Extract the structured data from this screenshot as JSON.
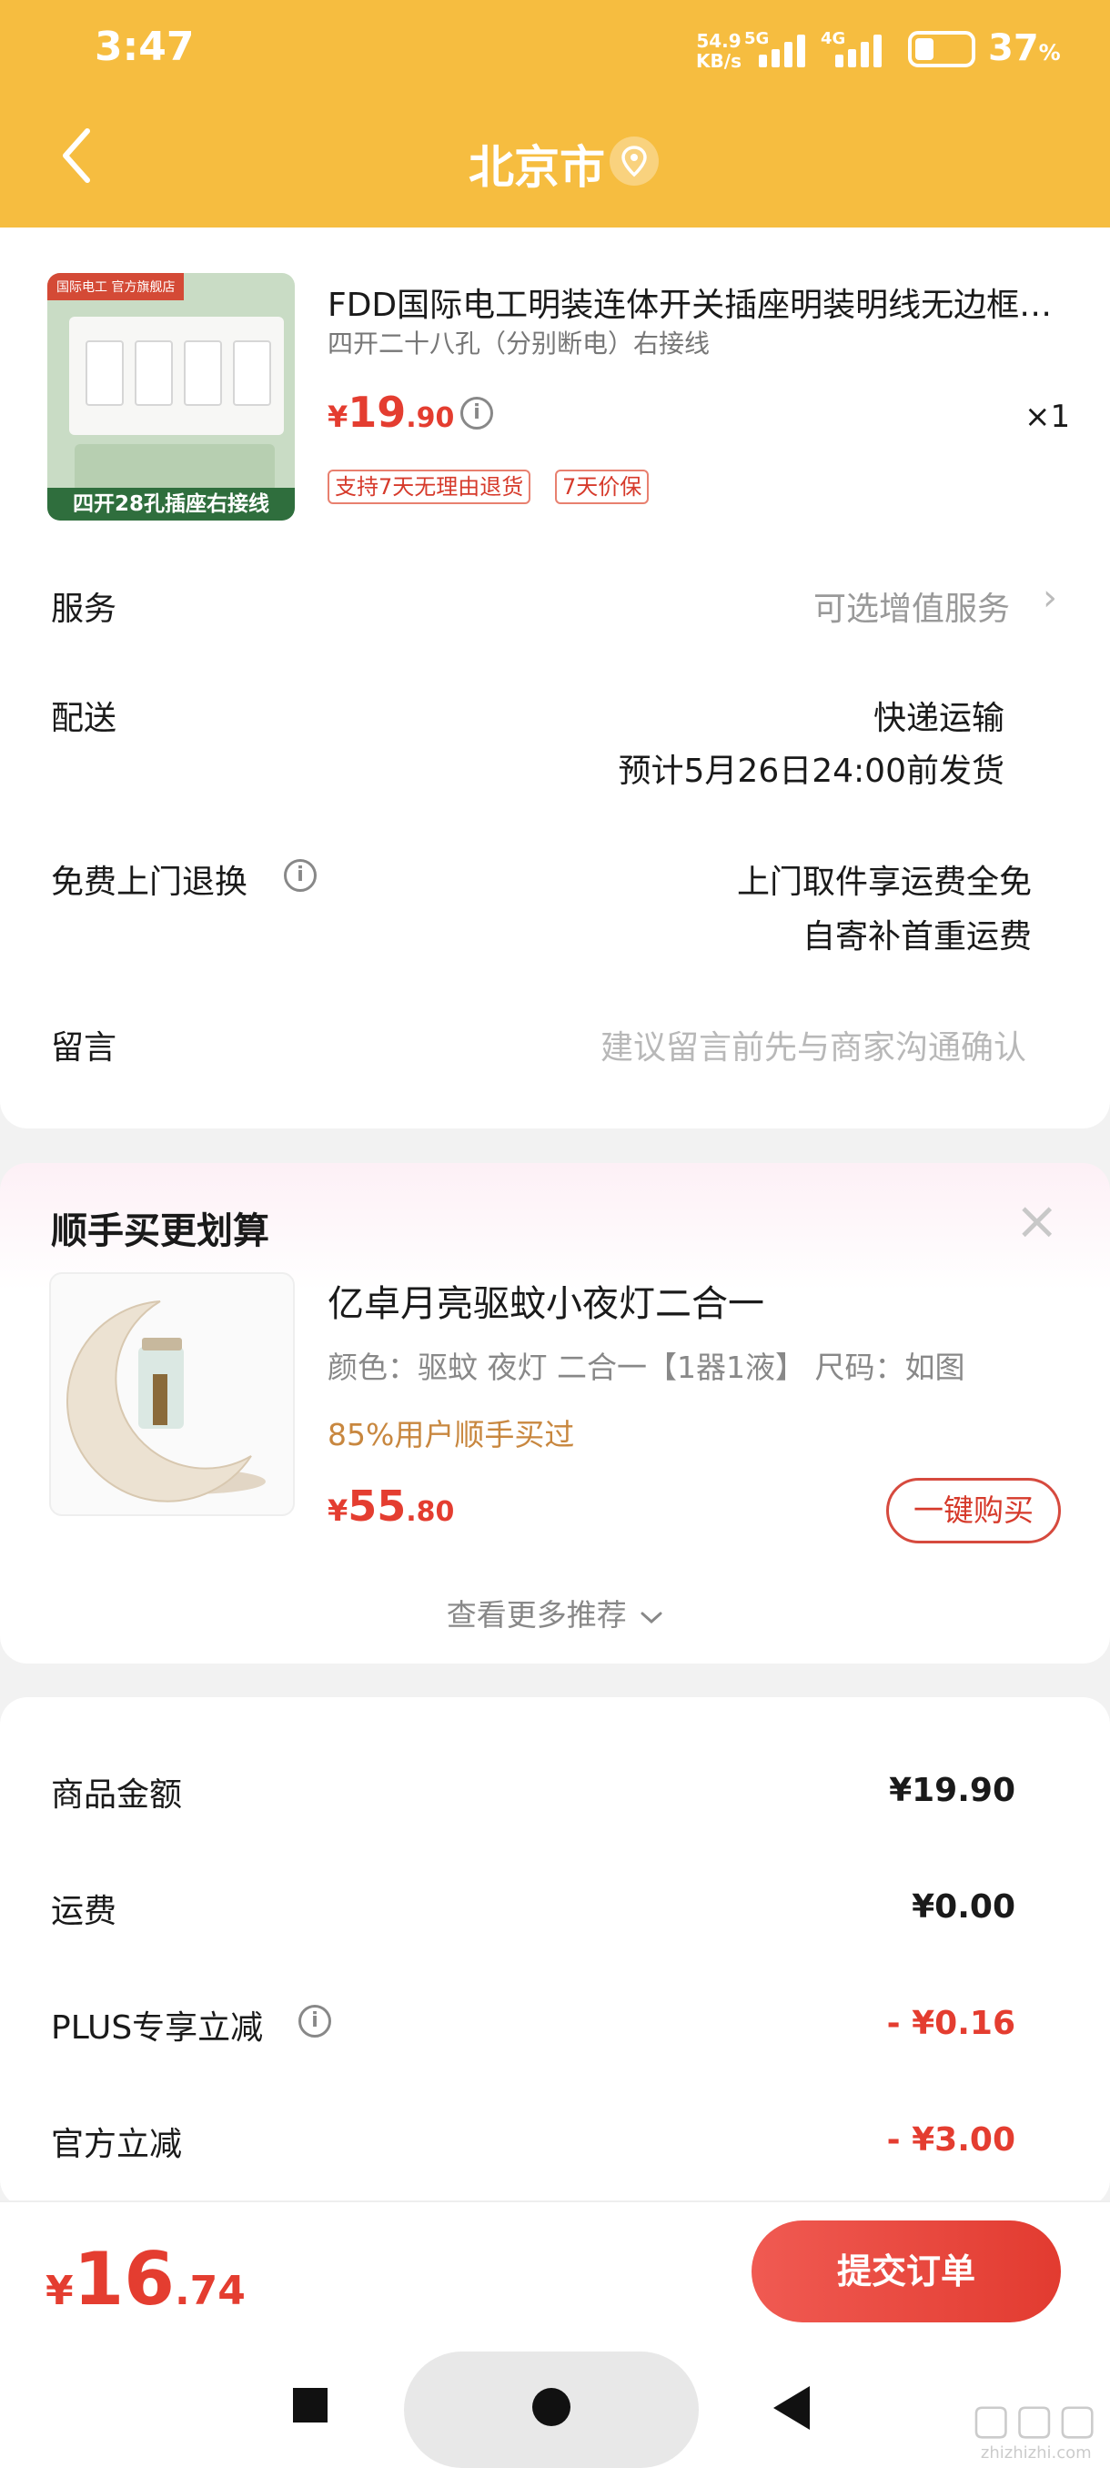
{
  "status": {
    "time": "3:47",
    "net_speed_value": "54.9",
    "net_speed_unit": "KB/s",
    "sig1_tag": "5G",
    "sig2_tag": "4G",
    "battery_pct": "37",
    "battery_unit": "%"
  },
  "header": {
    "title": "北京市",
    "icons": [
      "back-chevron-icon",
      "location-pin-icon"
    ]
  },
  "product": {
    "image_badge": "国际电工 官方旗舰店",
    "image_caption": "四开28孔插座右接线",
    "title": "FDD国际电工明装连体开关插座明装明线无边框四开二十八孔",
    "spec": "四开二十八孔（分别断电）右接线",
    "price_currency": "¥",
    "price_int": "19",
    "price_dec": ".90",
    "quantity": "×1",
    "tags": [
      "支持7天无理由退货",
      "7天价保"
    ]
  },
  "rows": {
    "service_label": "服务",
    "service_value": "可选增值服务",
    "delivery_label": "配送",
    "delivery_value_1": "快递运输",
    "delivery_value_2": "预计5月26日24:00前发货",
    "return_label": "免费上门退换",
    "return_value_1": "上门取件享运费全免",
    "return_value_2": "自寄补首重运费",
    "message_label": "留言",
    "message_placeholder": "建议留言前先与商家沟通确认"
  },
  "recommend": {
    "title": "顺手买更划算",
    "close": "×",
    "name": "亿卓月亮驱蚊小夜灯二合一",
    "spec": "颜色：驱蚊 夜灯 二合一【1器1液】  尺码：如图",
    "bought": "85%用户顺手买过",
    "price_currency": "¥",
    "price_int": "55",
    "price_dec": ".80",
    "buy_label": "一键购买",
    "more_label": "查看更多推荐"
  },
  "summary": {
    "items_label": "商品金额",
    "items_value": "¥19.90",
    "shipping_label": "运费",
    "shipping_value": "¥0.00",
    "plus_label": "PLUS专享立减",
    "plus_value": "- ¥0.16",
    "official_label": "官方立减",
    "official_value": "- ¥3.00"
  },
  "footer": {
    "total_currency": "¥",
    "total_int": "16",
    "total_dec": ".74",
    "submit_label": "提交订单"
  },
  "watermark": {
    "text": "zhizhizhi.com"
  },
  "colors": {
    "header": "#f6bd40",
    "price_red": "#e43d30",
    "bought_gold": "#c8873f"
  }
}
